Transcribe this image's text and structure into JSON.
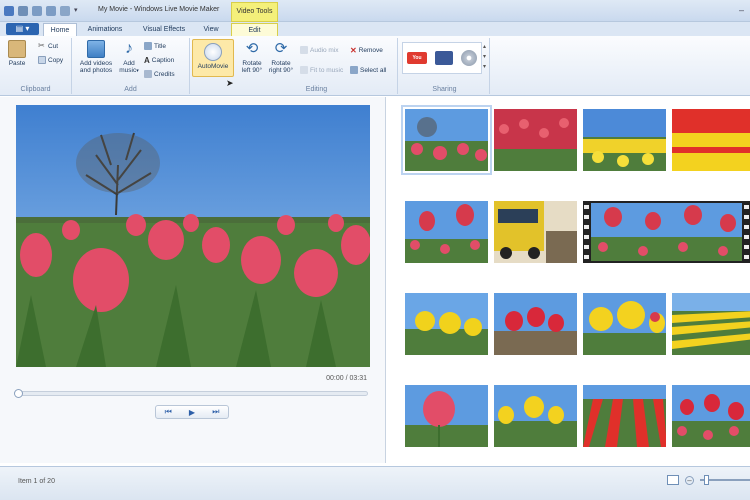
{
  "window": {
    "title": "My Movie - Windows Live Movie Maker",
    "contextual_tab_group": "Video Tools"
  },
  "tabs": [
    "Home",
    "Animations",
    "Visual Effects",
    "View",
    "Edit"
  ],
  "ribbon": {
    "clipboard": {
      "label": "Clipboard",
      "paste": "Paste",
      "cut": "Cut",
      "copy": "Copy"
    },
    "add": {
      "label": "Add",
      "add_videos": "Add videos and photos",
      "add_music": "Add music",
      "title": "Title",
      "caption": "Caption",
      "credits": "Credits"
    },
    "automovie": "AutoMovie",
    "editing": {
      "label": "Editing",
      "rotate_left": "Rotate left 90°",
      "rotate_right": "Rotate right 90°",
      "audio_mix": "Audio mix",
      "fit_to_music": "Fit to music",
      "remove": "Remove",
      "select_all": "Select all"
    },
    "sharing": {
      "label": "Sharing",
      "services": [
        "youtube-icon",
        "facebook-icon",
        "dvd-icon"
      ]
    }
  },
  "preview": {
    "time": "00:00 / 03:31"
  },
  "status": {
    "text": "Item 1 of 20"
  },
  "storyboard": {
    "thumbnails": [
      "tulips-tree",
      "red-tulip-field",
      "yellow-field-sky",
      "yellow-red-rows",
      "red-tulips-closeup",
      "yellow-bus",
      "red-tulips-film",
      "yellow-tulips",
      "red-tulips-sky",
      "yellow-tulips-closeup",
      "yellow-stripes",
      "pink-tulip",
      "yellow-tulips-sky",
      "red-rows",
      "red-tulips-blue"
    ]
  },
  "colors": {
    "accent": "#2c65b1",
    "contextual": "#f4f07a"
  }
}
